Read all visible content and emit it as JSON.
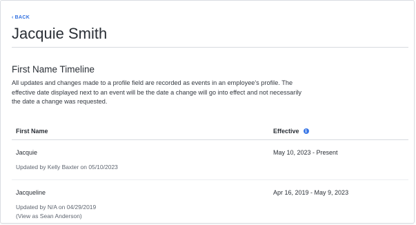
{
  "nav": {
    "back_label": "BACK"
  },
  "header": {
    "employee_name": "Jacquie Smith"
  },
  "section": {
    "title": "First Name Timeline",
    "description": "All updates and changes made to a profile field are recorded as events in an employee's profile. The effective date displayed next to an event will be the date a change will go into effect and not necessarily the date a change was requested."
  },
  "table": {
    "columns": {
      "first_name": "First Name",
      "effective": "Effective",
      "info_icon": "info-icon"
    },
    "rows": [
      {
        "name": "Jacquie",
        "meta_line1": "Updated by Kelly Baxter on 05/10/2023",
        "meta_line2": "",
        "effective": "May 10, 2023 - Present"
      },
      {
        "name": "Jacqueline",
        "meta_line1": "Updated by N/A on 04/29/2019",
        "meta_line2": "(View as Sean Anderson)",
        "effective": "Apr 16, 2019 - May 9, 2023"
      }
    ]
  },
  "colors": {
    "accent": "#2f6fe0",
    "info_icon": "#3b78e7",
    "text": "#2a2f36",
    "muted": "#5e6570",
    "divider": "#d7dadf"
  }
}
